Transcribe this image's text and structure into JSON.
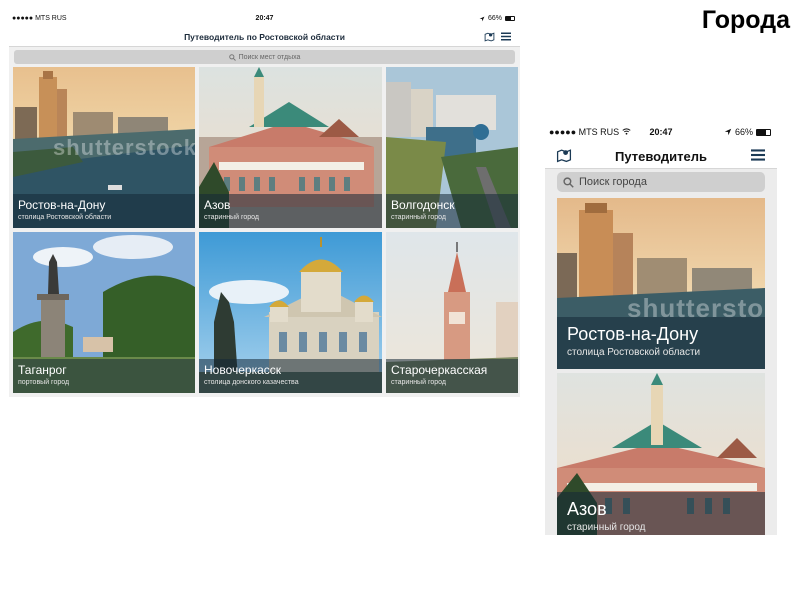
{
  "slide": {
    "title": "Города"
  },
  "tablet": {
    "status": {
      "carrier": "●●●●● MTS RUS",
      "time": "20:47",
      "battery": "66%"
    },
    "nav": {
      "title": "Путеводитель по Ростовской области"
    },
    "search": {
      "placeholder": "Поиск мест отдыха"
    },
    "cities": [
      {
        "name": "Ростов-на-Дону",
        "subtitle": "столица Ростовской области"
      },
      {
        "name": "Азов",
        "subtitle": "старинный город"
      },
      {
        "name": "Волгодонск",
        "subtitle": "старинный город"
      },
      {
        "name": "Таганрог",
        "subtitle": "портовый город"
      },
      {
        "name": "Новочеркасск",
        "subtitle": "столица донского казачества"
      },
      {
        "name": "Старочеркасская",
        "subtitle": "старинный город"
      }
    ],
    "watermark": "shutterstock"
  },
  "phone": {
    "status": {
      "carrier": "●●●●● MTS RUS",
      "time": "20:47",
      "battery": "66%"
    },
    "nav": {
      "title": "Путеводитель"
    },
    "search": {
      "placeholder": "Поиск города"
    },
    "cities": [
      {
        "name": "Ростов-на-Дону",
        "subtitle": "столица Ростовской области"
      },
      {
        "name": "Азов",
        "subtitle": "старинный город"
      }
    ],
    "watermark": "shutterstock"
  },
  "icons": {
    "map": "map-pin-icon",
    "menu": "hamburger-menu-icon",
    "search": "search-icon",
    "location": "location-arrow-icon",
    "wifi": "wifi-icon"
  }
}
